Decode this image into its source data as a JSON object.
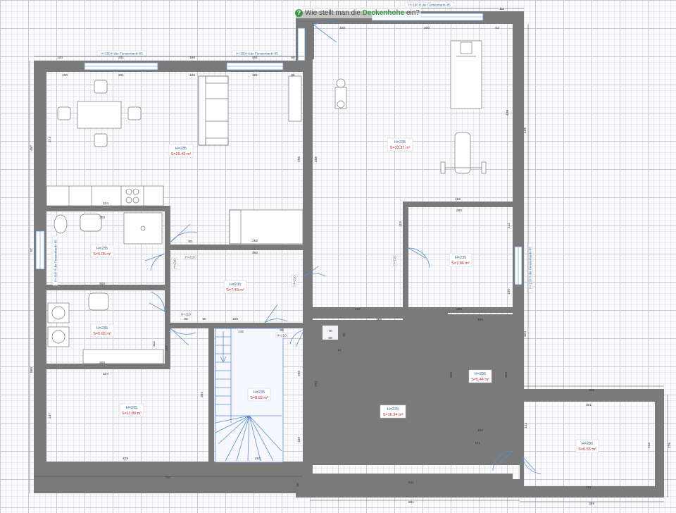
{
  "tooltip": {
    "icon": "help-question-icon",
    "text_before": "Wie stellt man die ",
    "highlight": "Deckenhohe",
    "text_after": " ein?"
  },
  "rooms": [
    {
      "id": "kitchen-living",
      "height": "H=235",
      "area": "S=29.43 m²"
    },
    {
      "id": "fitness",
      "height": "H=235",
      "area": "S=33.37 m²"
    },
    {
      "id": "bathroom",
      "height": "H=235",
      "area": "S=6.05 m²"
    },
    {
      "id": "hallway",
      "height": "H=235",
      "area": "S=7.43 m²"
    },
    {
      "id": "small-right",
      "height": "H=235",
      "area": "S=7.86 m²"
    },
    {
      "id": "laundry",
      "height": "H=235",
      "area": "S=5.65 m²"
    },
    {
      "id": "bottom-left",
      "height": "H=235",
      "area": "S=11.80 m²"
    },
    {
      "id": "stairs",
      "height": "H=235",
      "area": "S=8.83 m²"
    },
    {
      "id": "center-bottom",
      "height": "H=235",
      "area": "S=16.34 m²"
    },
    {
      "id": "storage",
      "height": "H=235",
      "area": "S=5.44 m²"
    },
    {
      "id": "annex",
      "height": "H=235",
      "area": "S=6.55 m²"
    }
  ],
  "window_labels": [
    {
      "id": "w1",
      "text": "H=150  H der Fensterbank=85"
    },
    {
      "id": "w2",
      "text": "H=150  H der Fensterbank=85"
    },
    {
      "id": "w3",
      "text": "H=150  H der Fensterbank=85"
    },
    {
      "id": "w4",
      "text": "H=150  H der Fensterbank=85"
    },
    {
      "id": "w5",
      "text": "H=150  H der Fensterbank=85"
    }
  ],
  "door_labels": [
    {
      "id": "d1",
      "text": "H=210"
    },
    {
      "id": "d2",
      "text": "H=210"
    },
    {
      "id": "d3",
      "text": "H=210"
    },
    {
      "id": "d4",
      "text": "H=210"
    },
    {
      "id": "d5",
      "text": "H=210"
    },
    {
      "id": "d6",
      "text": "H=210"
    }
  ],
  "dimensions": [
    {
      "id": "top-130",
      "text": "130"
    },
    {
      "id": "top-201",
      "text": "201"
    },
    {
      "id": "top-188",
      "text": "188"
    },
    {
      "id": "top-181",
      "text": "181"
    },
    {
      "id": "top-59",
      "text": "59"
    },
    {
      "id": "top-158",
      "text": "158"
    },
    {
      "id": "top-300",
      "text": "300"
    },
    {
      "id": "top-111",
      "text": "111"
    },
    {
      "id": "top-61",
      "text": "61"
    },
    {
      "id": "left-467",
      "text": "467"
    },
    {
      "id": "left-271",
      "text": "271"
    },
    {
      "id": "left-92",
      "text": "92"
    },
    {
      "id": "left-566",
      "text": "566"
    },
    {
      "id": "left-247",
      "text": "247"
    },
    {
      "id": "k-100",
      "text": "100"
    },
    {
      "id": "k-201",
      "text": "201"
    },
    {
      "id": "k-188",
      "text": "188"
    },
    {
      "id": "k-181",
      "text": "181"
    },
    {
      "id": "k-86",
      "text": "86"
    },
    {
      "id": "k-324",
      "text": "324"
    },
    {
      "id": "k-262",
      "text": "262"
    },
    {
      "id": "k-466",
      "text": "466"
    },
    {
      "id": "f-466",
      "text": "466"
    },
    {
      "id": "f-408",
      "text": "408"
    },
    {
      "id": "f-439",
      "text": "439"
    },
    {
      "id": "f-262",
      "text": "262"
    },
    {
      "id": "f-247",
      "text": "247"
    },
    {
      "id": "b-300a",
      "text": "300"
    },
    {
      "id": "b-300b",
      "text": "300"
    },
    {
      "id": "b-300c",
      "text": "300"
    },
    {
      "id": "h-262",
      "text": "262"
    },
    {
      "id": "h-160",
      "text": "160"
    },
    {
      "id": "h-80a",
      "text": "80"
    },
    {
      "id": "h-80b",
      "text": "80"
    },
    {
      "id": "h-90a",
      "text": "90"
    },
    {
      "id": "h-90b",
      "text": "90"
    },
    {
      "id": "s-280a",
      "text": "280"
    },
    {
      "id": "s-280b",
      "text": "280"
    },
    {
      "id": "s-113",
      "text": "113"
    },
    {
      "id": "s-112",
      "text": "112"
    },
    {
      "id": "s-100",
      "text": "100"
    },
    {
      "id": "s-358",
      "text": "358"
    },
    {
      "id": "s-169",
      "text": "169"
    },
    {
      "id": "st-142",
      "text": "142"
    },
    {
      "id": "st-364",
      "text": "364"
    },
    {
      "id": "st-262",
      "text": "262"
    },
    {
      "id": "st-256",
      "text": "256"
    },
    {
      "id": "st-160",
      "text": "160"
    },
    {
      "id": "l-324",
      "text": "324"
    },
    {
      "id": "l-428",
      "text": "428"
    },
    {
      "id": "l-114",
      "text": "114"
    },
    {
      "id": "l-117",
      "text": "117"
    },
    {
      "id": "l-66",
      "text": "66"
    },
    {
      "id": "l-710",
      "text": "710"
    },
    {
      "id": "c-294",
      "text": "294"
    },
    {
      "id": "c-541",
      "text": "541"
    },
    {
      "id": "c-601",
      "text": "601"
    },
    {
      "id": "c-322a",
      "text": "322"
    },
    {
      "id": "c-322b",
      "text": "322"
    },
    {
      "id": "c-169",
      "text": "169"
    },
    {
      "id": "c-101",
      "text": "101"
    },
    {
      "id": "c-324",
      "text": "324"
    },
    {
      "id": "a-369",
      "text": "369"
    },
    {
      "id": "a-351a",
      "text": "351"
    },
    {
      "id": "a-351b",
      "text": "351"
    },
    {
      "id": "a-369b",
      "text": "369"
    },
    {
      "id": "a-244",
      "text": "244"
    },
    {
      "id": "a-276",
      "text": "276"
    },
    {
      "id": "a-124",
      "text": "124"
    },
    {
      "id": "n-70",
      "text": "70"
    },
    {
      "id": "n-59",
      "text": "59"
    },
    {
      "id": "n-65",
      "text": "65"
    },
    {
      "id": "n-12",
      "text": "12"
    }
  ]
}
